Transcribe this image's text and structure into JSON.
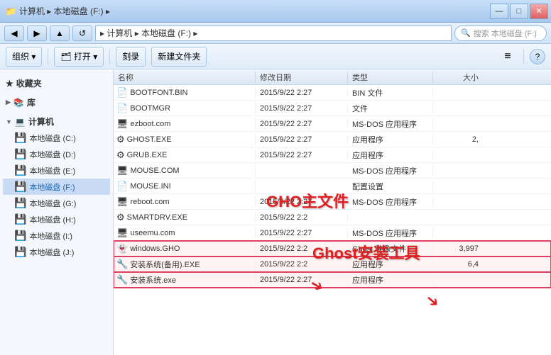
{
  "titleBar": {
    "path": "计算机 ▸ 本地磁盘 (F:) ▸",
    "minBtn": "—",
    "maxBtn": "□",
    "closeBtn": "✕"
  },
  "addressBar": {
    "backBtn": "◀",
    "forwardBtn": "▶",
    "upBtn": "▲",
    "refreshBtn": "↺",
    "address": " ▸ 计算机 ▸ 本地磁盘 (F:) ▸",
    "searchPlaceholder": "搜索 本地磁盘 (F:)",
    "searchIcon": "🔍"
  },
  "toolbar": {
    "organizeLabel": "组织 ▾",
    "openLabel": "🗂 打开 ▾",
    "burnLabel": "刻录",
    "newFolderLabel": "新建文件夹",
    "viewIcon": "≡",
    "helpIcon": "?"
  },
  "sidebar": {
    "sections": [
      {
        "id": "favorites",
        "icon": "★",
        "label": "收藏夹",
        "expanded": true,
        "items": []
      },
      {
        "id": "library",
        "icon": "📚",
        "label": "库",
        "expanded": false,
        "items": []
      },
      {
        "id": "computer",
        "icon": "💻",
        "label": "计算机",
        "expanded": true,
        "items": [
          {
            "id": "drive-c",
            "icon": "💾",
            "label": "本地磁盘 (C:)",
            "active": false
          },
          {
            "id": "drive-d",
            "icon": "💾",
            "label": "本地磁盘 (D:)",
            "active": false
          },
          {
            "id": "drive-e",
            "icon": "💾",
            "label": "本地磁盘 (E:)",
            "active": false
          },
          {
            "id": "drive-f",
            "icon": "💾",
            "label": "本地磁盘 (F:)",
            "active": true
          },
          {
            "id": "drive-g",
            "icon": "💾",
            "label": "本地磁盘 (G:)",
            "active": false
          },
          {
            "id": "drive-h",
            "icon": "💾",
            "label": "本地磁盘 (H:)",
            "active": false
          },
          {
            "id": "drive-i",
            "icon": "💾",
            "label": "本地磁盘 (I:)",
            "active": false
          },
          {
            "id": "drive-j",
            "icon": "💾",
            "label": "本地磁盘 (J:)",
            "active": false
          }
        ]
      }
    ]
  },
  "columns": {
    "name": "名称",
    "date": "修改日期",
    "type": "类型",
    "size": "大小"
  },
  "files": [
    {
      "id": "bootfont",
      "icon": "📄",
      "name": "BOOTFONT.BIN",
      "date": "2015/9/22 2:27",
      "type": "BIN 文件",
      "size": "",
      "highlighted": false
    },
    {
      "id": "bootmgr",
      "icon": "📄",
      "name": "BOOTMGR",
      "date": "2015/9/22 2:27",
      "type": "文件",
      "size": "",
      "highlighted": false
    },
    {
      "id": "ezboot",
      "icon": "🖥",
      "name": "ezboot.com",
      "date": "2015/9/22 2:27",
      "type": "MS-DOS 应用程序",
      "size": "",
      "highlighted": false
    },
    {
      "id": "ghost-exe",
      "icon": "⚙",
      "name": "GHOST.EXE",
      "date": "2015/9/22 2:27",
      "type": "应用程序",
      "size": "2,",
      "highlighted": false
    },
    {
      "id": "grub-exe",
      "icon": "⚙",
      "name": "GRUB.EXE",
      "date": "2015/9/22 2:27",
      "type": "应用程序",
      "size": "",
      "highlighted": false
    },
    {
      "id": "mouse-com",
      "icon": "🖥",
      "name": "MOUSE.COM",
      "date": "",
      "type": "MS-DOS 应用程序",
      "size": "",
      "highlighted": false
    },
    {
      "id": "mouse-ini",
      "icon": "📄",
      "name": "MOUSE.INI",
      "date": "",
      "type": "配置设置",
      "size": "",
      "highlighted": false
    },
    {
      "id": "reboot-com",
      "icon": "🖥",
      "name": "reboot.com",
      "date": "2015/9/22 2:27",
      "type": "MS-DOS 应用程序",
      "size": "",
      "highlighted": false
    },
    {
      "id": "smartdrv",
      "icon": "⚙",
      "name": "SMARTDRV.EXE",
      "date": "2015/9/22 2:2",
      "type": "",
      "size": "",
      "highlighted": false
    },
    {
      "id": "useemu",
      "icon": "🖥",
      "name": "useemu.com",
      "date": "2015/9/22 2:27",
      "type": "MS-DOS 应用程序",
      "size": "",
      "highlighted": false
    },
    {
      "id": "windows-gho",
      "icon": "👻",
      "name": "windows.GHO",
      "date": "2015/9/22 2:2",
      "type": "Ghost 映像文件",
      "size": "3,997",
      "highlighted": true
    },
    {
      "id": "install-bak",
      "icon": "🔧",
      "name": "安装系统(备用).EXE",
      "date": "2015/9/22 2:2",
      "type": "应用程序",
      "size": "6,4",
      "highlighted": true
    },
    {
      "id": "install-exe",
      "icon": "🔧",
      "name": "安装系统.exe",
      "date": "2015/9/22 2:27",
      "type": "应用程序",
      "size": "",
      "highlighted": true
    }
  ],
  "annotations": {
    "ghoLabel": "GHO主文件",
    "ghostLabel": "Ghost安装工具"
  }
}
